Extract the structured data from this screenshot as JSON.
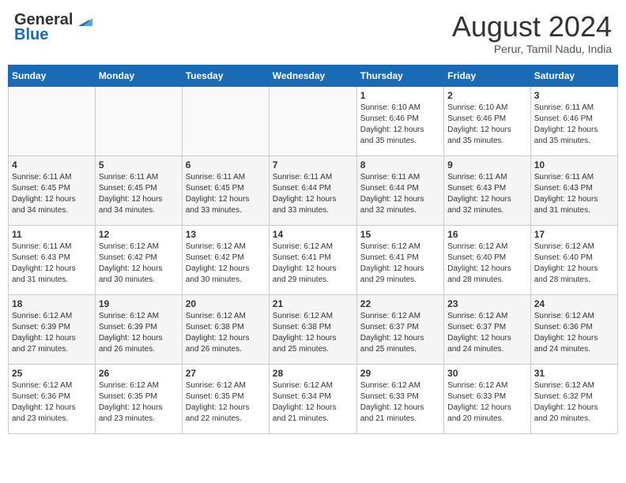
{
  "header": {
    "logo_general": "General",
    "logo_blue": "Blue",
    "month_year": "August 2024",
    "location": "Perur, Tamil Nadu, India"
  },
  "days_of_week": [
    "Sunday",
    "Monday",
    "Tuesday",
    "Wednesday",
    "Thursday",
    "Friday",
    "Saturday"
  ],
  "weeks": [
    [
      {
        "day": "",
        "info": ""
      },
      {
        "day": "",
        "info": ""
      },
      {
        "day": "",
        "info": ""
      },
      {
        "day": "",
        "info": ""
      },
      {
        "day": "1",
        "info": "Sunrise: 6:10 AM\nSunset: 6:46 PM\nDaylight: 12 hours\nand 35 minutes."
      },
      {
        "day": "2",
        "info": "Sunrise: 6:10 AM\nSunset: 6:46 PM\nDaylight: 12 hours\nand 35 minutes."
      },
      {
        "day": "3",
        "info": "Sunrise: 6:11 AM\nSunset: 6:46 PM\nDaylight: 12 hours\nand 35 minutes."
      }
    ],
    [
      {
        "day": "4",
        "info": "Sunrise: 6:11 AM\nSunset: 6:45 PM\nDaylight: 12 hours\nand 34 minutes."
      },
      {
        "day": "5",
        "info": "Sunrise: 6:11 AM\nSunset: 6:45 PM\nDaylight: 12 hours\nand 34 minutes."
      },
      {
        "day": "6",
        "info": "Sunrise: 6:11 AM\nSunset: 6:45 PM\nDaylight: 12 hours\nand 33 minutes."
      },
      {
        "day": "7",
        "info": "Sunrise: 6:11 AM\nSunset: 6:44 PM\nDaylight: 12 hours\nand 33 minutes."
      },
      {
        "day": "8",
        "info": "Sunrise: 6:11 AM\nSunset: 6:44 PM\nDaylight: 12 hours\nand 32 minutes."
      },
      {
        "day": "9",
        "info": "Sunrise: 6:11 AM\nSunset: 6:43 PM\nDaylight: 12 hours\nand 32 minutes."
      },
      {
        "day": "10",
        "info": "Sunrise: 6:11 AM\nSunset: 6:43 PM\nDaylight: 12 hours\nand 31 minutes."
      }
    ],
    [
      {
        "day": "11",
        "info": "Sunrise: 6:11 AM\nSunset: 6:43 PM\nDaylight: 12 hours\nand 31 minutes."
      },
      {
        "day": "12",
        "info": "Sunrise: 6:12 AM\nSunset: 6:42 PM\nDaylight: 12 hours\nand 30 minutes."
      },
      {
        "day": "13",
        "info": "Sunrise: 6:12 AM\nSunset: 6:42 PM\nDaylight: 12 hours\nand 30 minutes."
      },
      {
        "day": "14",
        "info": "Sunrise: 6:12 AM\nSunset: 6:41 PM\nDaylight: 12 hours\nand 29 minutes."
      },
      {
        "day": "15",
        "info": "Sunrise: 6:12 AM\nSunset: 6:41 PM\nDaylight: 12 hours\nand 29 minutes."
      },
      {
        "day": "16",
        "info": "Sunrise: 6:12 AM\nSunset: 6:40 PM\nDaylight: 12 hours\nand 28 minutes."
      },
      {
        "day": "17",
        "info": "Sunrise: 6:12 AM\nSunset: 6:40 PM\nDaylight: 12 hours\nand 28 minutes."
      }
    ],
    [
      {
        "day": "18",
        "info": "Sunrise: 6:12 AM\nSunset: 6:39 PM\nDaylight: 12 hours\nand 27 minutes."
      },
      {
        "day": "19",
        "info": "Sunrise: 6:12 AM\nSunset: 6:39 PM\nDaylight: 12 hours\nand 26 minutes."
      },
      {
        "day": "20",
        "info": "Sunrise: 6:12 AM\nSunset: 6:38 PM\nDaylight: 12 hours\nand 26 minutes."
      },
      {
        "day": "21",
        "info": "Sunrise: 6:12 AM\nSunset: 6:38 PM\nDaylight: 12 hours\nand 25 minutes."
      },
      {
        "day": "22",
        "info": "Sunrise: 6:12 AM\nSunset: 6:37 PM\nDaylight: 12 hours\nand 25 minutes."
      },
      {
        "day": "23",
        "info": "Sunrise: 6:12 AM\nSunset: 6:37 PM\nDaylight: 12 hours\nand 24 minutes."
      },
      {
        "day": "24",
        "info": "Sunrise: 6:12 AM\nSunset: 6:36 PM\nDaylight: 12 hours\nand 24 minutes."
      }
    ],
    [
      {
        "day": "25",
        "info": "Sunrise: 6:12 AM\nSunset: 6:36 PM\nDaylight: 12 hours\nand 23 minutes."
      },
      {
        "day": "26",
        "info": "Sunrise: 6:12 AM\nSunset: 6:35 PM\nDaylight: 12 hours\nand 23 minutes."
      },
      {
        "day": "27",
        "info": "Sunrise: 6:12 AM\nSunset: 6:35 PM\nDaylight: 12 hours\nand 22 minutes."
      },
      {
        "day": "28",
        "info": "Sunrise: 6:12 AM\nSunset: 6:34 PM\nDaylight: 12 hours\nand 21 minutes."
      },
      {
        "day": "29",
        "info": "Sunrise: 6:12 AM\nSunset: 6:33 PM\nDaylight: 12 hours\nand 21 minutes."
      },
      {
        "day": "30",
        "info": "Sunrise: 6:12 AM\nSunset: 6:33 PM\nDaylight: 12 hours\nand 20 minutes."
      },
      {
        "day": "31",
        "info": "Sunrise: 6:12 AM\nSunset: 6:32 PM\nDaylight: 12 hours\nand 20 minutes."
      }
    ]
  ]
}
